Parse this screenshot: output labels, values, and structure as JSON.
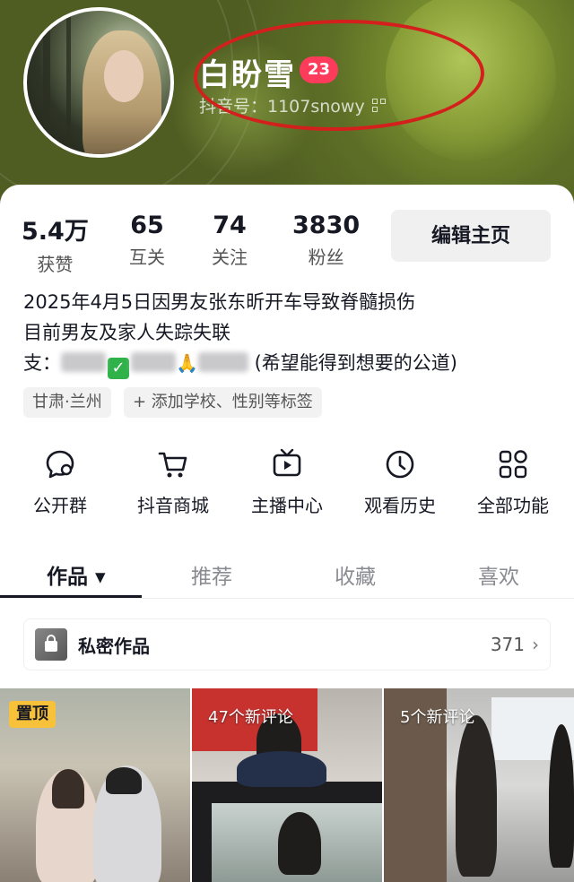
{
  "profile": {
    "display_name": "白盼雪",
    "age": "23",
    "douyin_id": "抖音号：1107snowy"
  },
  "stats": [
    {
      "value": "5.4万",
      "label": "获赞"
    },
    {
      "value": "65",
      "label": "互关"
    },
    {
      "value": "74",
      "label": "关注"
    },
    {
      "value": "3830",
      "label": "粉丝"
    }
  ],
  "edit_button": "编辑主页",
  "bio": {
    "line1": "2025年4月5日因男友张东昕开车导致脊髓损伤",
    "line2": "目前男友及家人失踪失联",
    "line3_prefix": "支：",
    "line3_suffix": "(希望能得到想要的公道)"
  },
  "tags": {
    "location": "甘肃·兰州",
    "add_tags": "+ 添加学校、性别等标签"
  },
  "functions": [
    {
      "label": "公开群",
      "icon": "group-chat-icon"
    },
    {
      "label": "抖音商城",
      "icon": "shopping-cart-icon"
    },
    {
      "label": "主播中心",
      "icon": "tv-play-icon"
    },
    {
      "label": "观看历史",
      "icon": "clock-icon"
    },
    {
      "label": "全部功能",
      "icon": "grid-apps-icon"
    }
  ],
  "tabs": [
    {
      "label": "作品 ▾",
      "active": true
    },
    {
      "label": "推荐",
      "active": false
    },
    {
      "label": "收藏",
      "active": false
    },
    {
      "label": "喜欢",
      "active": false
    }
  ],
  "private_works": {
    "label": "私密作品",
    "count": "371"
  },
  "videos": [
    {
      "badge": "置顶"
    },
    {
      "badge": "47个新评论"
    },
    {
      "badge": "5个新评论"
    }
  ],
  "colors": {
    "accent": "#ff3b5c",
    "pin": "#f7c23a",
    "annotation": "#d3201d"
  }
}
